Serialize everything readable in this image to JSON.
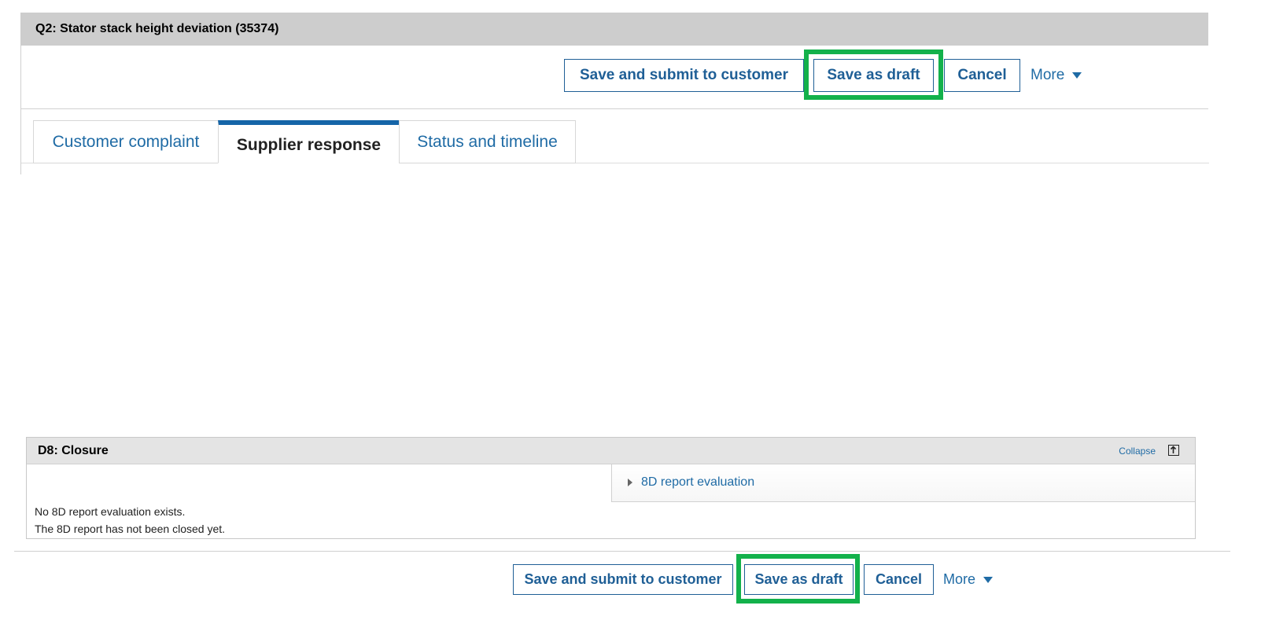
{
  "header": {
    "title": "Q2: Stator stack height deviation (35374)"
  },
  "toolbar": {
    "submit_label": "Save and submit to customer",
    "draft_label": "Save as draft",
    "cancel_label": "Cancel",
    "more_label": "More"
  },
  "tabs": [
    {
      "label": "Customer complaint",
      "active": false
    },
    {
      "label": "Supplier response",
      "active": true
    },
    {
      "label": "Status and timeline",
      "active": false
    }
  ],
  "section": {
    "title": "D8: Closure",
    "collapse_label": "Collapse",
    "collapse_icon": "collapse-up-arrow-icon",
    "eval_label": "8D report evaluation",
    "message1": "No 8D report evaluation exists.",
    "message2": "The 8D report has not been closed yet."
  },
  "colors": {
    "accent": "#1f5f96",
    "highlight": "#13b14b",
    "header_bg": "#cdcdcd",
    "active_tab_bar": "#1565a8"
  }
}
